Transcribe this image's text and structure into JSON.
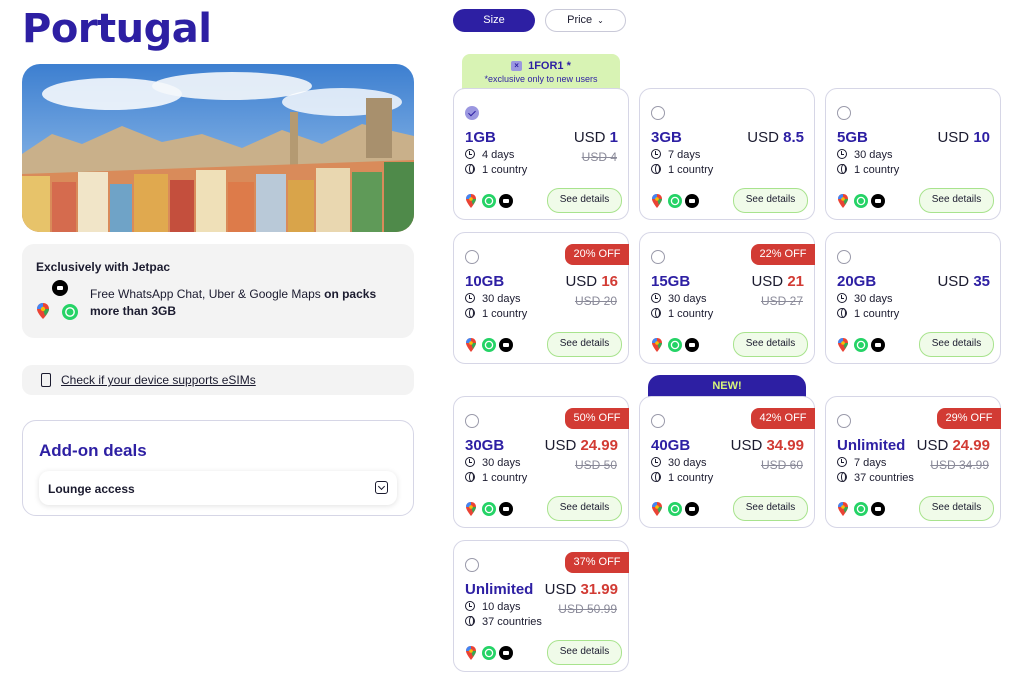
{
  "page": {
    "title": "Portugal"
  },
  "filters": {
    "size_label": "Size",
    "price_label": "Price"
  },
  "exclusive": {
    "heading": "Exclusively with Jetpac",
    "text_plain": "Free WhatsApp Chat, Uber & Google Maps ",
    "text_bold": "on packs more than 3GB"
  },
  "esim_check": {
    "label": "Check if your device supports eSIMs"
  },
  "addons": {
    "heading": "Add-on deals",
    "item_label": "Lounge access"
  },
  "promo": {
    "code": "1FOR1 *",
    "note": "*exclusive only to new users"
  },
  "new_tag": "NEW!",
  "see_details_label": "See details",
  "currency": "USD",
  "plans": [
    {
      "data": "1GB",
      "price": "1",
      "original": "USD 4",
      "duration": "4 days",
      "coverage": "1 country",
      "discount": "",
      "selected": true
    },
    {
      "data": "3GB",
      "price": "8.5",
      "original": "",
      "duration": "7 days",
      "coverage": "1 country",
      "discount": "",
      "selected": false
    },
    {
      "data": "5GB",
      "price": "10",
      "original": "",
      "duration": "30 days",
      "coverage": "1 country",
      "discount": "",
      "selected": false
    },
    {
      "data": "10GB",
      "price": "16",
      "original": "USD 20",
      "duration": "30 days",
      "coverage": "1 country",
      "discount": "20% OFF",
      "selected": false
    },
    {
      "data": "15GB",
      "price": "21",
      "original": "USD 27",
      "duration": "30 days",
      "coverage": "1 country",
      "discount": "22% OFF",
      "selected": false
    },
    {
      "data": "20GB",
      "price": "35",
      "original": "",
      "duration": "30 days",
      "coverage": "1 country",
      "discount": "",
      "selected": false
    },
    {
      "data": "30GB",
      "price": "24.99",
      "original": "USD 50",
      "duration": "30 days",
      "coverage": "1 country",
      "discount": "50% OFF",
      "selected": false
    },
    {
      "data": "40GB",
      "price": "34.99",
      "original": "USD 60",
      "duration": "30 days",
      "coverage": "1 country",
      "discount": "42% OFF",
      "selected": false
    },
    {
      "data": "Unlimited",
      "price": "24.99",
      "original": "USD 34.99",
      "duration": "7 days",
      "coverage": "37 countries",
      "discount": "29% OFF",
      "selected": false
    },
    {
      "data": "Unlimited",
      "price": "31.99",
      "original": "USD 50.99",
      "duration": "10 days",
      "coverage": "37 countries",
      "discount": "37% OFF",
      "selected": false
    }
  ],
  "colors": {
    "brand": "#2d1fa3",
    "sale": "#d23b34",
    "cta_border": "#a8e38d",
    "promo_bg": "#d8f3b4",
    "new_text": "#d7f57b"
  },
  "icons": {
    "duration": "clock-icon",
    "coverage": "globe-icon",
    "apps": [
      "google-maps-icon",
      "whatsapp-icon",
      "uber-icon"
    ]
  }
}
